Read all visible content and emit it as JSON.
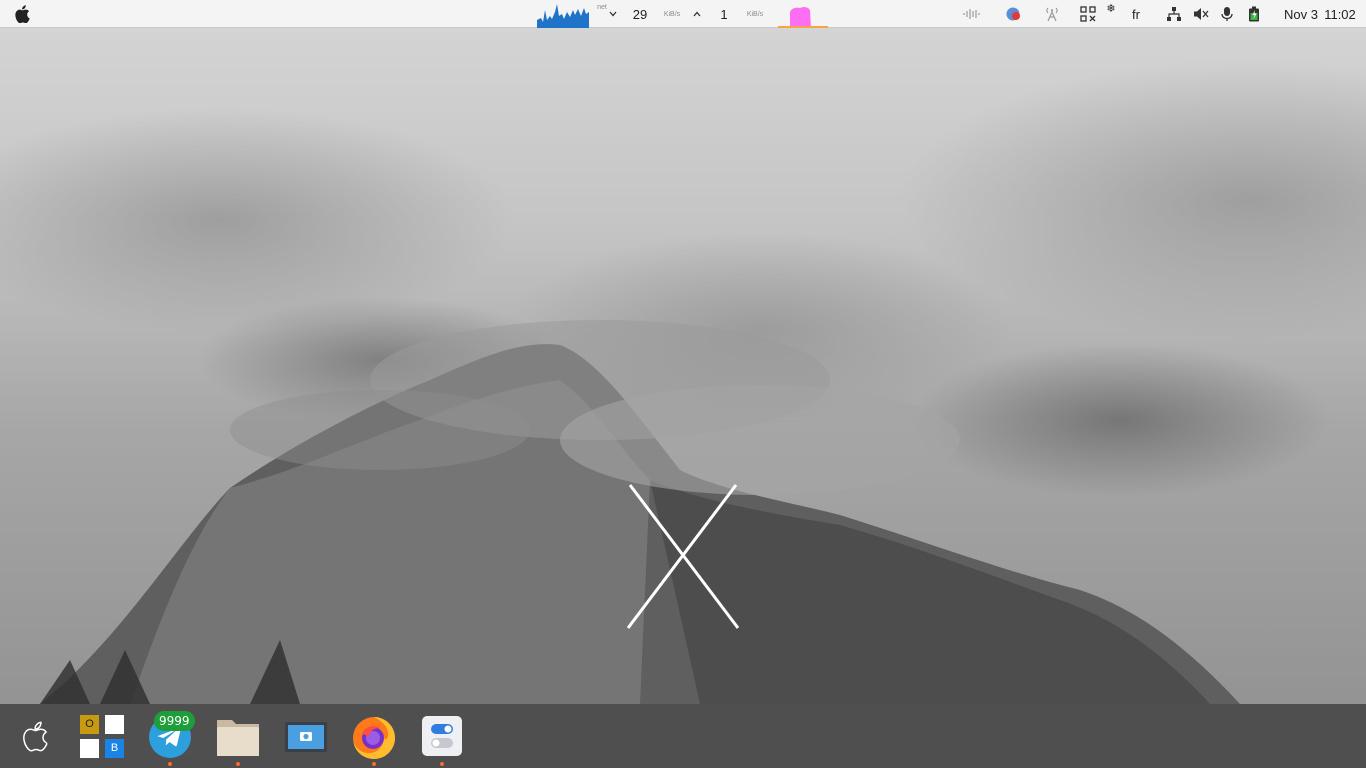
{
  "menubar": {
    "net_label": "net",
    "download_value": "29",
    "download_unit": "KiB/s",
    "upload_value": "1",
    "upload_unit": "KiB/s",
    "keyboard_layout": "fr",
    "date": "Nov 3",
    "time": "11:02",
    "icons": [
      "apple-logo-icon",
      "network-graph-icon",
      "chevron-down-icon",
      "chevron-up-icon",
      "system-monitor-icon",
      "audio-wave-icon",
      "notification-badge-icon",
      "radio-tower-icon",
      "qr-code-icon",
      "snowflake-icon",
      "network-wired-icon",
      "volume-muted-icon",
      "microphone-icon",
      "battery-icon"
    ]
  },
  "dock": {
    "items": [
      {
        "name": "applications-menu",
        "icon": "apple-logo-icon"
      },
      {
        "name": "office-suite",
        "icon": "office-grid-icon",
        "tile_o": "O",
        "tile_b": "B"
      },
      {
        "name": "telegram",
        "icon": "telegram-icon",
        "badge": "9999"
      },
      {
        "name": "files",
        "icon": "folder-icon"
      },
      {
        "name": "screenshot",
        "icon": "camera-icon"
      },
      {
        "name": "firefox",
        "icon": "firefox-icon"
      },
      {
        "name": "settings",
        "icon": "toggle-settings-icon"
      }
    ]
  },
  "colors": {
    "menubar_bg": "#f5f5f5",
    "dock_bg": "#3c3c3c",
    "run_indicator": "#ff6a2a",
    "badge": "#1e9e3a",
    "graph_blue": "#1f73c8",
    "monitor_pink": "#ff6ef2"
  }
}
